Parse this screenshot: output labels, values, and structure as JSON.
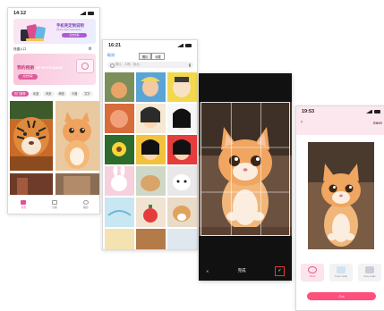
{
  "phone1": {
    "time": "14:12",
    "banner": {
      "title": "手机壳定制说明",
      "subtitle": "Phone case instructions",
      "button": "点击查看"
    },
    "quick_entry": "快捷入口",
    "album": {
      "title": "我的相册",
      "title_en": "MY PHOTO ALBUM",
      "button": "点击查看"
    },
    "tabs": [
      "热门推荐",
      "动漫",
      "风景",
      "萌宠",
      "卡通",
      "文字"
    ],
    "nav": [
      "首页",
      "分类",
      "我的"
    ]
  },
  "phone2": {
    "time": "16:21",
    "back": "取消",
    "segments": [
      "照片",
      "收藏"
    ],
    "search_placeholder": "照片、人物、地点..."
  },
  "phone3": {
    "done_label": "完成",
    "cancel_icon": "close-icon",
    "confirm_icon": "check-icon"
  },
  "phone4": {
    "time": "19:53",
    "save": "Save",
    "options": [
      "Ultrat",
      "Color scale",
      "Gray scale"
    ],
    "cut_button": "Cut"
  },
  "colors": {
    "accent_pink": "#e0509a",
    "cut_button": "#ff4f7d",
    "crop_confirm": "#e53935"
  }
}
